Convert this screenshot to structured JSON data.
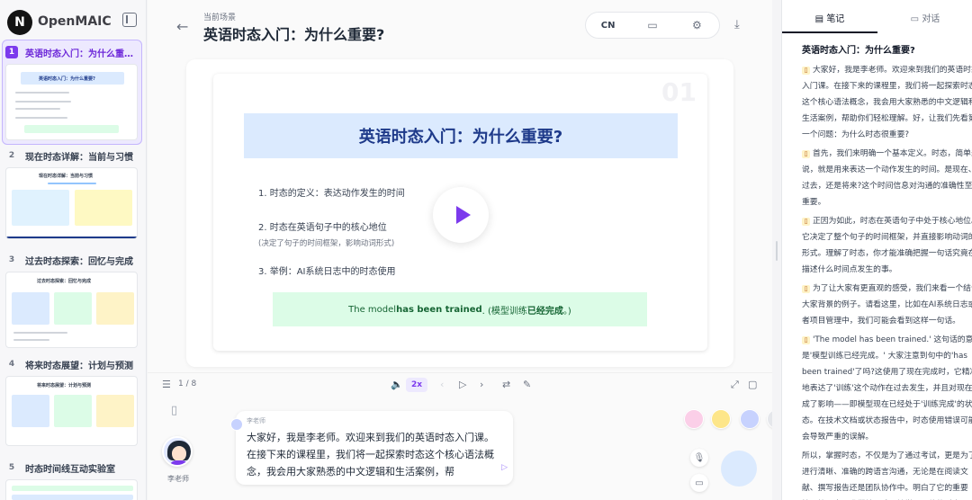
{
  "brand": {
    "name": "OpenMAIC",
    "logo_letter": "N"
  },
  "slides": [
    {
      "num": "1",
      "title": "英语时态入门：为什么重…",
      "thumb_title": "英语时态入门：为什么重要?",
      "active": true
    },
    {
      "num": "2",
      "title": "现在时态详解：当前与习惯",
      "thumb_title": "现在时态详解：当前与习惯",
      "active": false
    },
    {
      "num": "3",
      "title": "过去时态探索：回忆与完成",
      "thumb_title": "过去时态探索：回忆与完成",
      "active": false
    },
    {
      "num": "4",
      "title": "将来时态展望：计划与预测",
      "thumb_title": "将来时态展望：计划与预测",
      "active": false
    },
    {
      "num": "5",
      "title": "时态时间线互动实验室",
      "thumb_title": "",
      "active": false
    }
  ],
  "header": {
    "scene_label": "当前场景",
    "title": "英语时态入门：为什么重要?",
    "lang": "CN"
  },
  "slide": {
    "number": "01",
    "banner": "英语时态入门：为什么重要?",
    "points": [
      "1. 时态的定义：表达动作发生的时间",
      "2. 时态在英语句子中的核心地位",
      "(决定了句子的时间框架，影响动词形式)",
      "3. 举例：AI系统日志中的时态使用"
    ],
    "example_pre": "The model ",
    "example_bold": "has been trained",
    "example_mid": ". (模型训练",
    "example_bold2": "已经完成",
    "example_post": "。)"
  },
  "controls": {
    "page": "1 / 8",
    "speed": "2x"
  },
  "teacher": {
    "name": "李老师",
    "bubble_name": "李老师",
    "speech": "大家好，我是李老师。欢迎来到我们的英语时态入门课。在接下来的课程里，我们将一起探索时态这个核心语法概念，我会用大家熟悉的中文逻辑和生活案例，帮"
  },
  "notes": {
    "tab_notes": "笔记",
    "tab_chat": "对话",
    "title": "英语时态入门：为什么重要?",
    "paragraphs": [
      "大家好，我是李老师。欢迎来到我们的英语时态入门课。在接下来的课程里，我们将一起探索时态这个核心语法概念，我会用大家熟悉的中文逻辑和生活案例，帮助你们轻松理解。好，让我们先看第一个问题：为什么时态很重要?",
      "首先，我们来明确一个基本定义。时态，简单来说，就是用来表达一个动作发生的时间。是现在、过去，还是将来?这个时间信息对沟通的准确性至关重要。",
      "正因为如此，时态在英语句子中处于核心地位。它决定了整个句子的时间框架，并直接影响动词的形式。理解了时态，你才能准确把握一句话究竟在描述什么时间点发生的事。",
      "为了让大家有更直观的感受，我们来看一个结合大家背景的例子。请看这里，比如在AI系统日志或者项目管理中，我们可能会看到这样一句话。",
      "'The model has been trained.' 这句话的意思是'模型训练已经完成。' 大家注意到句中的'has been trained'了吗?这使用了现在完成时，它精准地表达了'训练'这个动作在过去发生，并且对现在造成了影响——即模型现在已经处于'训练完成'的状态。在技术文档或状态报告中，时态使用错误可能会导致严重的误解。",
      "所以，掌握时态，不仅是为了通过考试，更是为了进行清晰、准确的跨语言沟通，无论是在阅读文献、撰写报告还是团队协作中。明白了它的重要性，接下来，我们就正式开始学习具体的时态。"
    ]
  }
}
